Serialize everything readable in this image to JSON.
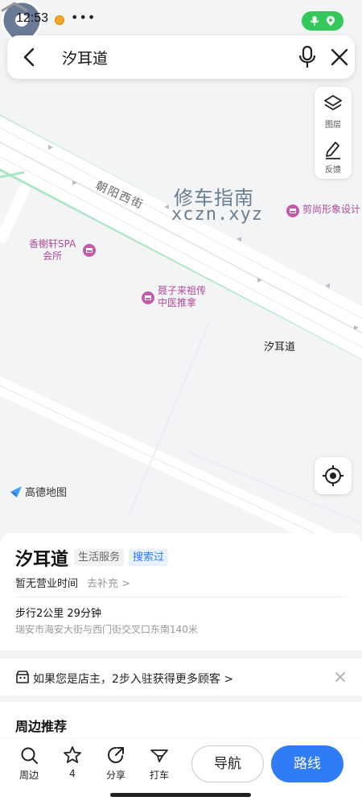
{
  "status_bar": {
    "time": "12:53",
    "dots": "•••",
    "pill_color": "#34c759"
  },
  "search": {
    "query": "汐耳道"
  },
  "map_tools": {
    "layers_label": "图层",
    "feedback_label": "反馈"
  },
  "map": {
    "street_name": "朝阳西街",
    "watermark_title": "修车指南",
    "watermark_sub": "xczn.xyz",
    "pois": [
      {
        "name": "剪尚形象设计"
      },
      {
        "name_line1": "香榭轩SPA",
        "name_line2": "会所"
      },
      {
        "name_line1": "聂子来祖传",
        "name_line2": "中医推拿"
      }
    ],
    "pin_label": "汐耳道",
    "brand": "高德地图",
    "road_color": "#a8e6c3"
  },
  "place": {
    "name": "汐耳道",
    "category": "生活服务",
    "searched_tag": "搜索过",
    "hours": "暂无营业时间",
    "hours_action": "去补充 >",
    "walk_info": "步行2公里 29分钟",
    "address": "瑞安市海安大街与西门街交叉口东南140米"
  },
  "owner_banner": {
    "text": "如果您是店主，2步入驻获得更多顾客 >"
  },
  "nearby": {
    "title": "周边推荐"
  },
  "actions": {
    "nearby": "周边",
    "star_count": "4",
    "share": "分享",
    "taxi": "打车",
    "navigate": "导航",
    "route": "路线",
    "accent": "#2f7cf6"
  }
}
